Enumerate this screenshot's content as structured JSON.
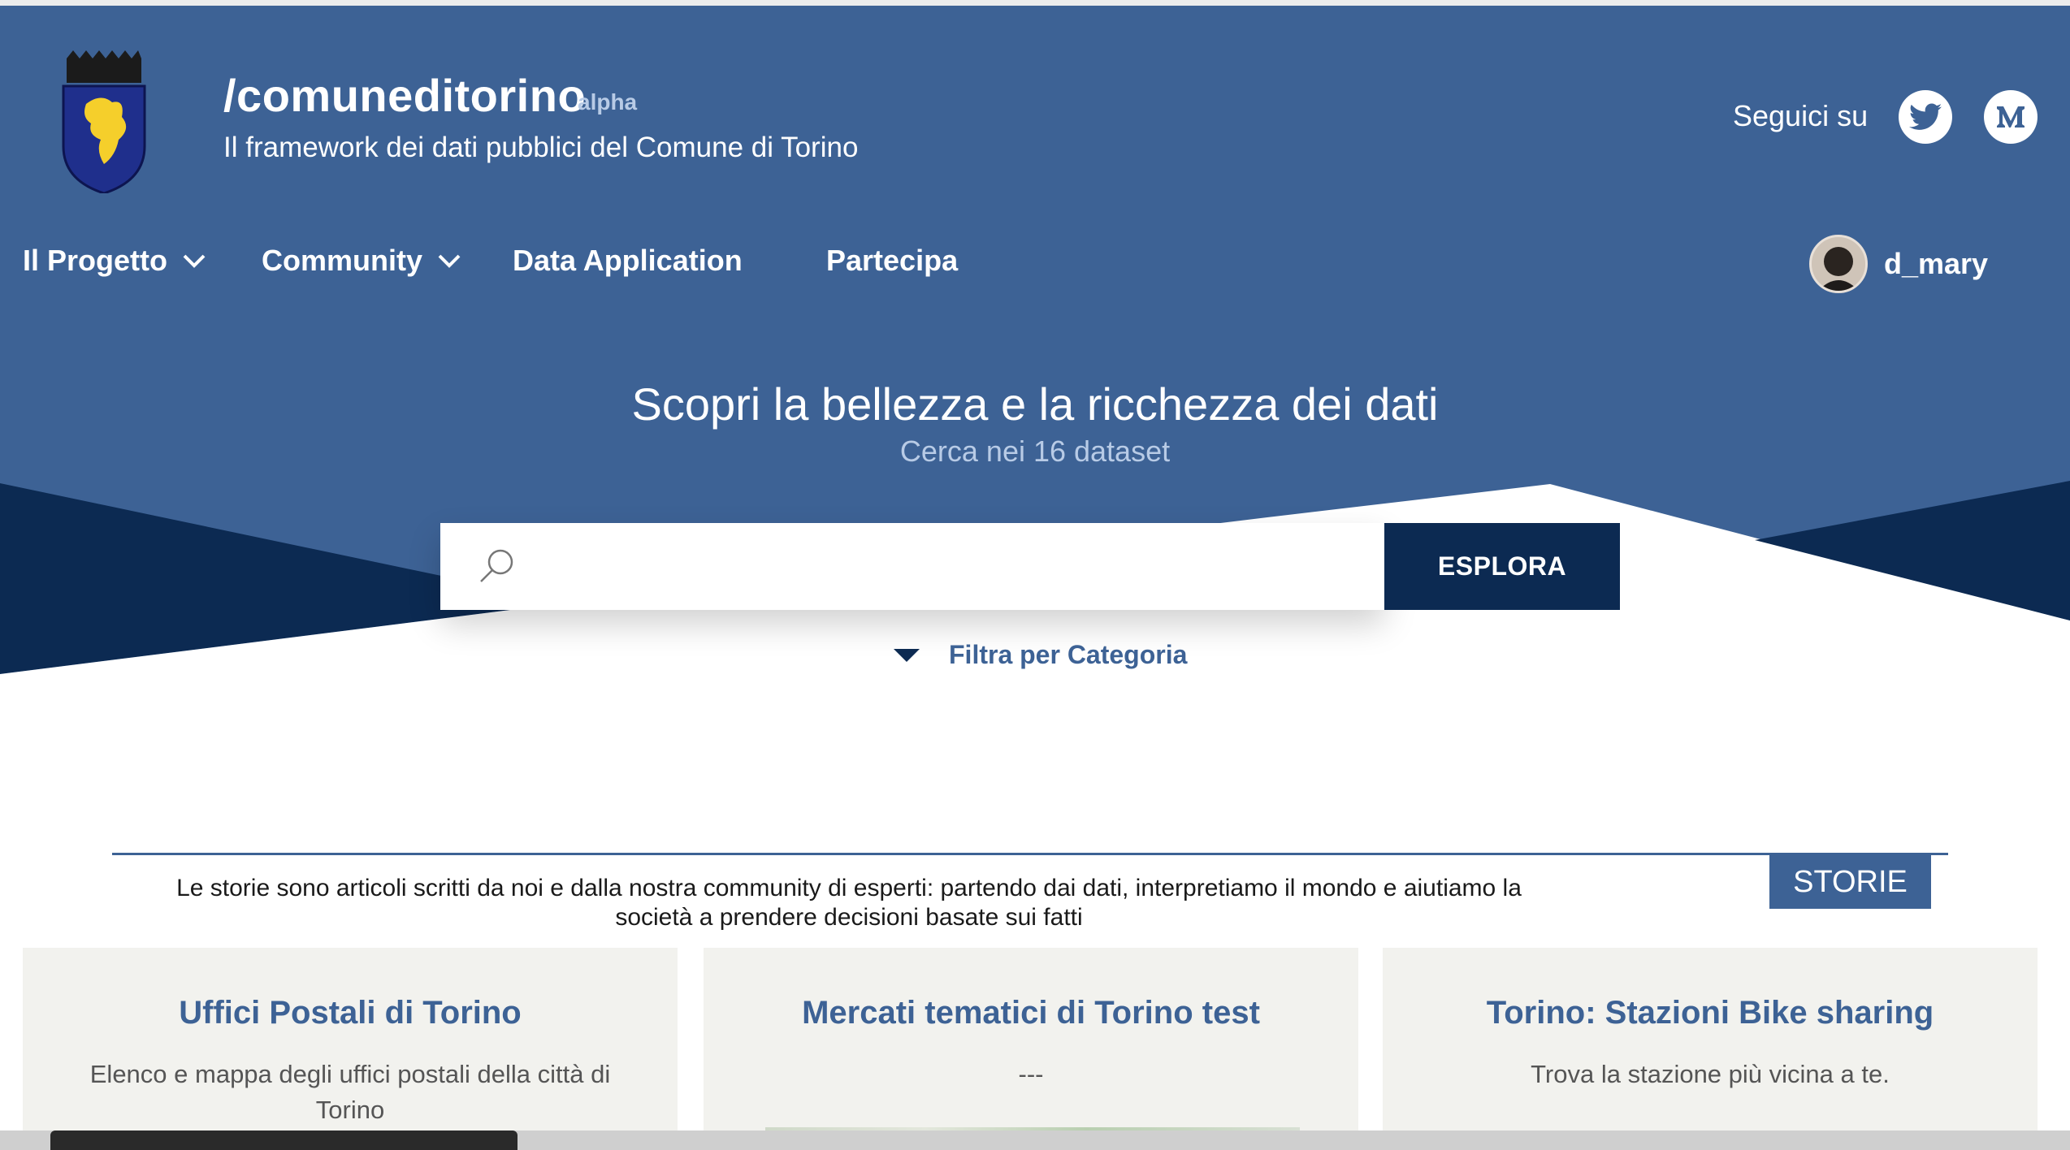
{
  "header": {
    "title": "/comuneditorino",
    "badge": "alpha",
    "subtitle": "Il framework dei dati pubblici del Comune di Torino",
    "follow_label": "Seguici su",
    "social": [
      "twitter-icon",
      "medium-icon"
    ]
  },
  "nav": {
    "items": [
      {
        "label": "Il Progetto",
        "has_dropdown": true
      },
      {
        "label": "Community",
        "has_dropdown": true
      },
      {
        "label": "Data Application",
        "has_dropdown": false
      },
      {
        "label": "Partecipa",
        "has_dropdown": false
      }
    ],
    "user": {
      "name": "d_mary"
    }
  },
  "hero": {
    "headline": "Scopri la bellezza e la ricchezza dei dati",
    "subheadline": "Cerca nei 16 dataset",
    "search": {
      "value": "",
      "placeholder": ""
    },
    "explore_button": "ESPLORA",
    "filter_label": "Filtra per Categoria"
  },
  "stories": {
    "tab_label": "STORIE",
    "description": "Le storie sono articoli scritti da noi e dalla nostra community di esperti: partendo dai dati, interpretiamo il mondo e aiutiamo la società a prendere decisioni basate sui fatti",
    "cards": [
      {
        "title": "Uffici Postali di Torino",
        "description": "Elenco e mappa degli uffici postali della città di Torino"
      },
      {
        "title": "Mercati tematici di Torino test",
        "description": "---"
      },
      {
        "title": "Torino: Stazioni Bike sharing",
        "description": "Trova la stazione più vicina a te."
      }
    ]
  },
  "colors": {
    "primary": "#3d6295",
    "dark": "#0c2a52",
    "light_text": "#b8cbe6",
    "card_bg": "#f2f2ee"
  }
}
